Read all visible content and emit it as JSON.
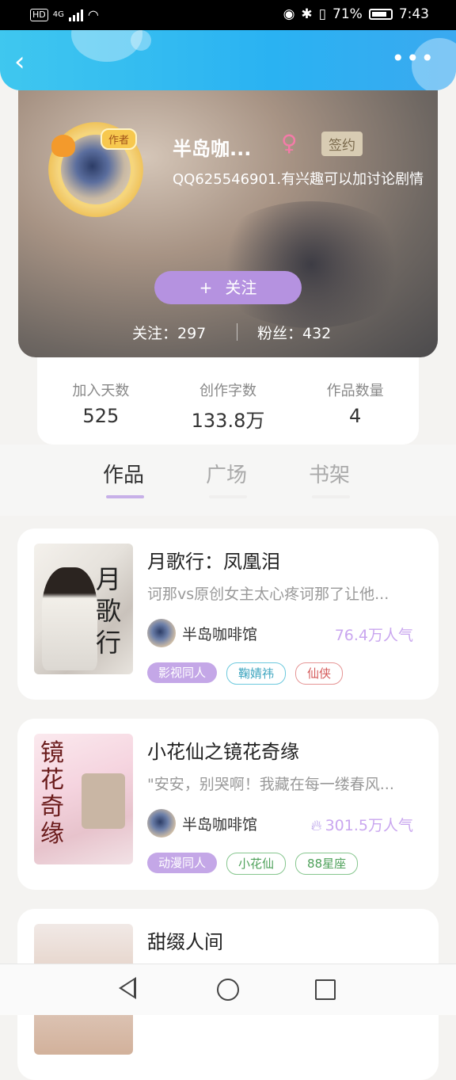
{
  "status": {
    "network": "4G",
    "battery": "71%",
    "time": "7:43"
  },
  "profile": {
    "author_tag": "作者",
    "nickname": "半岛咖...",
    "gender_symbol": "♀",
    "sign_badge": "签约",
    "bio": "QQ625546901.有兴趣可以加讨论剧情",
    "follow_plus": "+",
    "follow_label": "关注",
    "following": "关注：297",
    "fans": "粉丝：432"
  },
  "stats": [
    {
      "label": "加入天数",
      "value": "525"
    },
    {
      "label": "创作字数",
      "value": "133.8万"
    },
    {
      "label": "作品数量",
      "value": "4"
    }
  ],
  "tabs": [
    "作品",
    "广场",
    "书架"
  ],
  "books": [
    {
      "title": "月歌行：凤凰泪",
      "desc": "诃那vs原创女主太心疼诃那了让他...",
      "author": "半岛咖啡馆",
      "popularity": "76.4万人气",
      "cover_text": "月歌行",
      "tags": [
        "影视同人",
        "鞠婧祎",
        "仙侠"
      ]
    },
    {
      "title": "小花仙之镜花奇缘",
      "desc": "\"安安，别哭啊！我藏在每一缕春风...",
      "author": "半岛咖啡馆",
      "popularity": "301.5万人气",
      "cover_text": "镜花奇缘",
      "tags": [
        "动漫同人",
        "小花仙",
        "88星座"
      ]
    },
    {
      "title": "甜缀人间"
    }
  ],
  "colors": {
    "accent": "#b592e0",
    "topbar": "#2ab2f2"
  }
}
